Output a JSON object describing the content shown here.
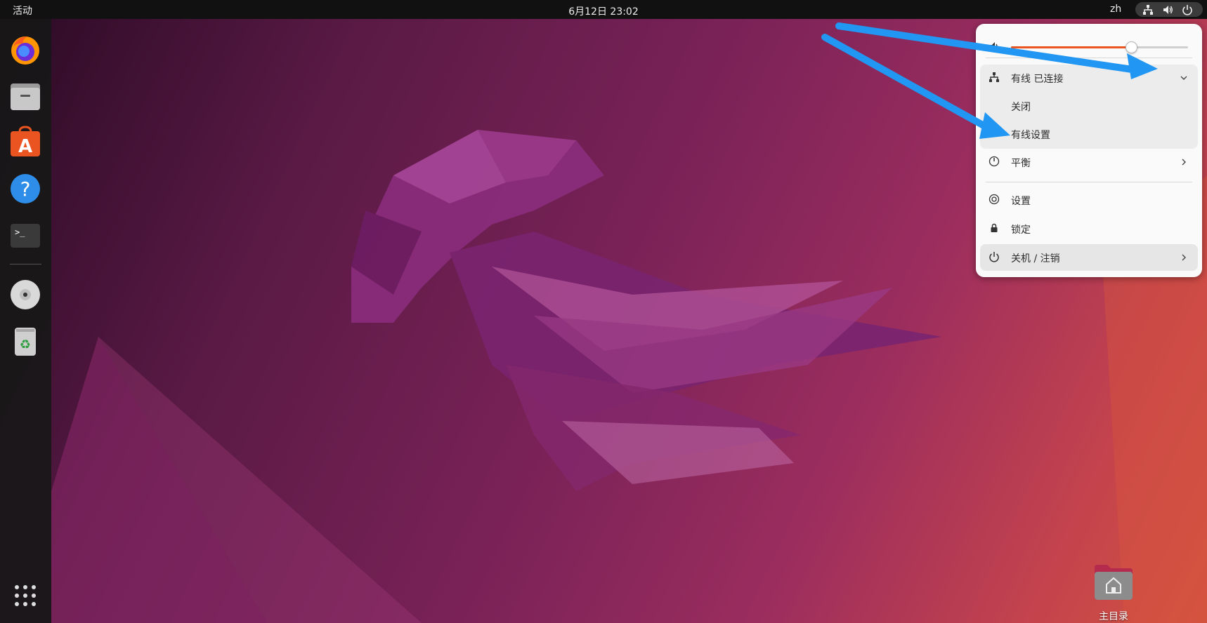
{
  "topbar": {
    "activities": "活动",
    "datetime": "6月12日  23:02",
    "language": "zh",
    "icons": [
      "network-wired-icon",
      "volume-icon",
      "power-icon"
    ]
  },
  "dock": {
    "apps": [
      {
        "name": "firefox",
        "icon": "firefox-icon"
      },
      {
        "name": "files",
        "icon": "files-icon"
      },
      {
        "name": "ubuntu-software",
        "icon": "software-store-icon"
      },
      {
        "name": "help",
        "icon": "help-icon"
      },
      {
        "name": "terminal",
        "icon": "terminal-icon"
      },
      {
        "name": "disc",
        "icon": "cd-drive-icon"
      },
      {
        "name": "trash",
        "icon": "trash-icon"
      }
    ],
    "show_apps_icon": "app-grid-icon"
  },
  "quick_settings": {
    "volume_percent": 68,
    "wired": {
      "label": "有线 已连接",
      "expanded": true,
      "sub_items": [
        "关闭",
        "有线设置"
      ]
    },
    "power_mode": {
      "label": "平衡"
    },
    "settings": {
      "label": "设置"
    },
    "lock": {
      "label": "锁定"
    },
    "power_off": {
      "label": "关机 / 注销"
    }
  },
  "desktop": {
    "home_folder_label": "主目录"
  },
  "colors": {
    "accent": "#e95420",
    "annotation_arrow": "#2196f3"
  }
}
